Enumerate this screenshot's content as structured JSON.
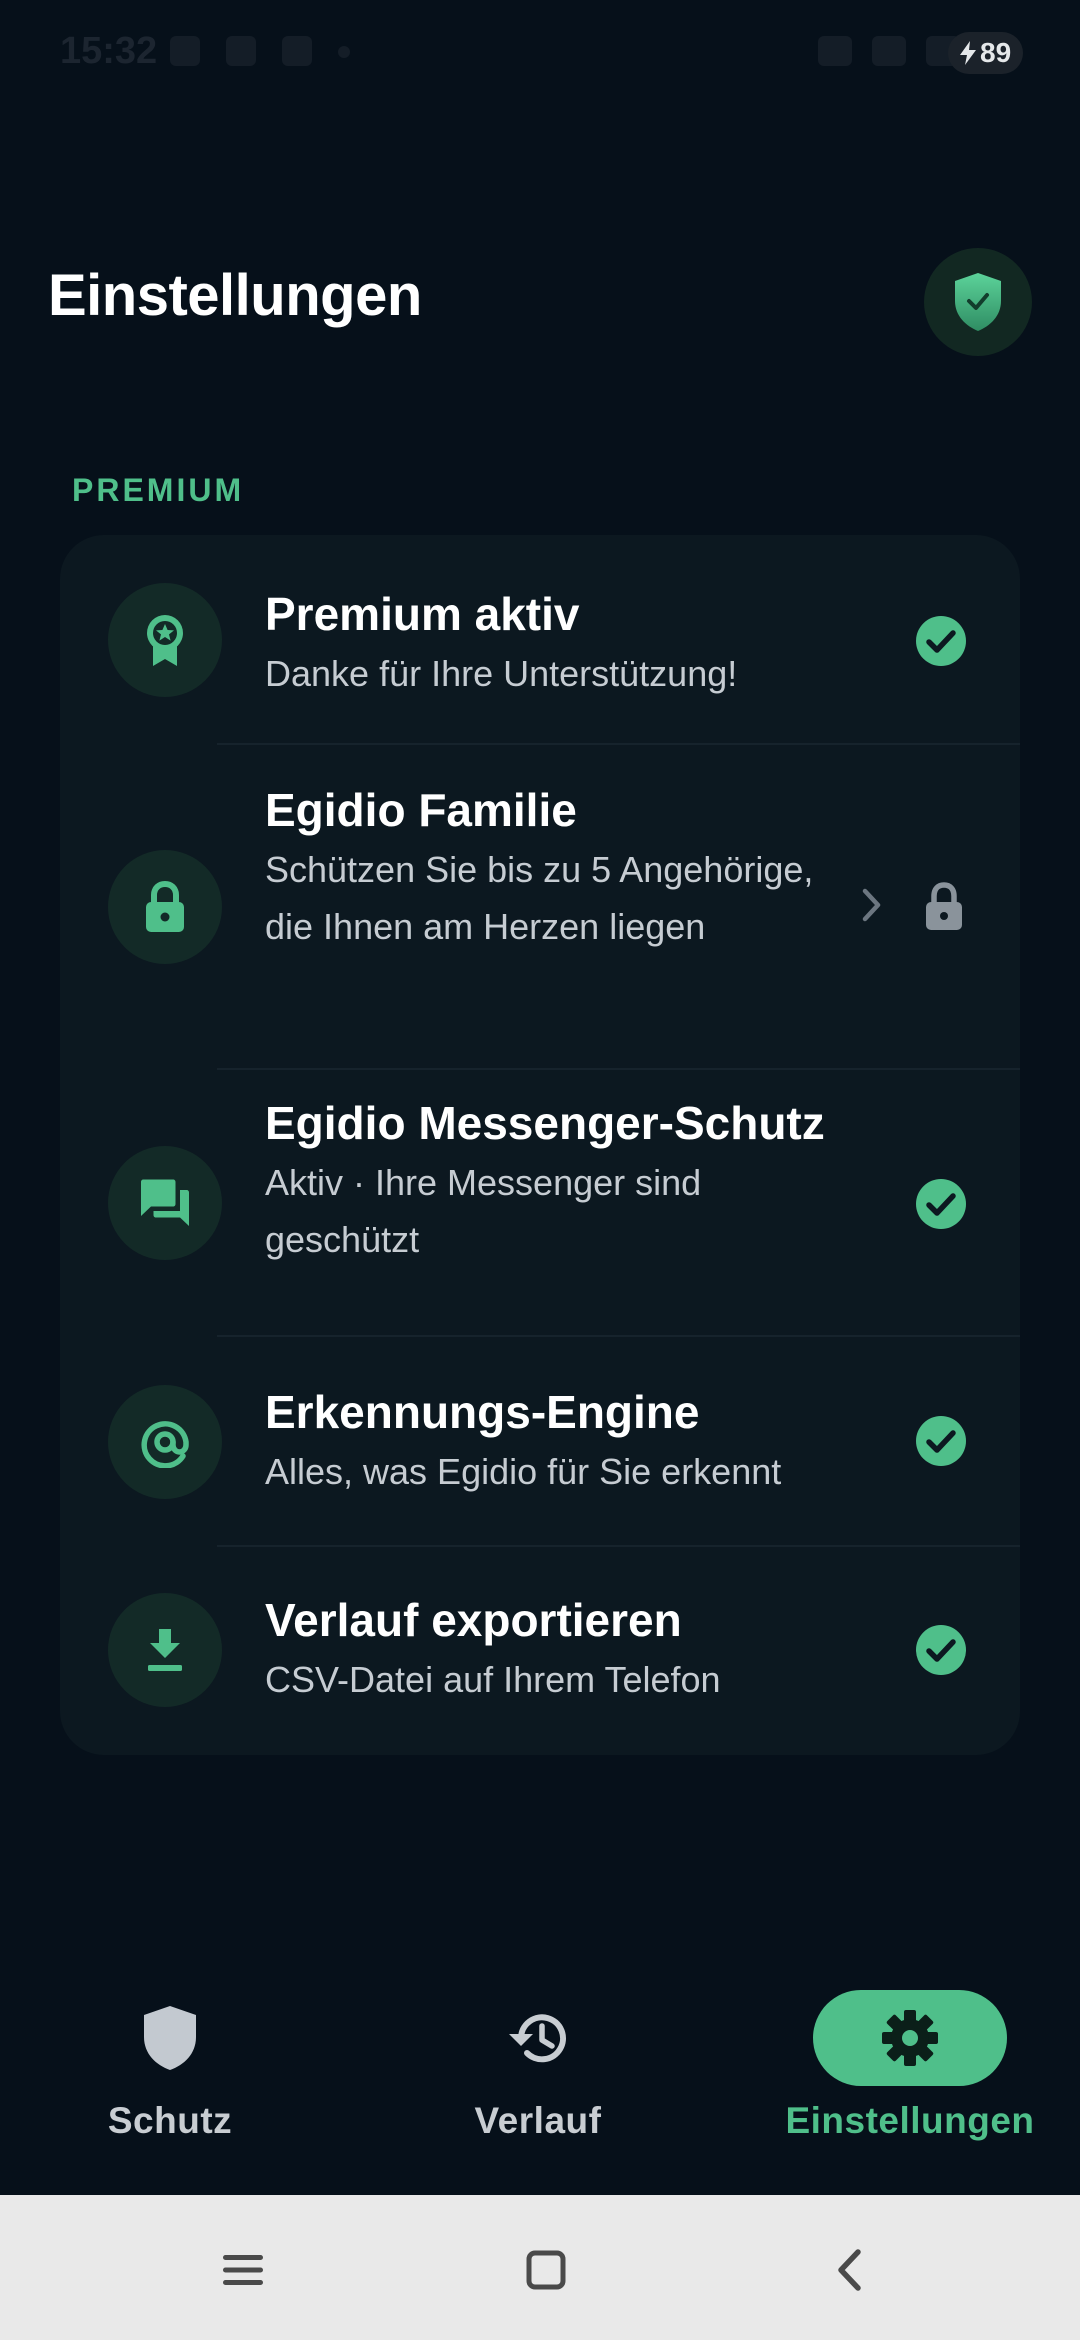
{
  "status_bar": {
    "time": "15:32",
    "battery_level": "89"
  },
  "header": {
    "title": "Einstellungen",
    "shield_button_icon": "shield-check-icon"
  },
  "section": {
    "label": "PREMIUM"
  },
  "items": [
    {
      "icon": "award-star-icon",
      "title": "Premium aktiv",
      "subtitle": "Danke für Ihre Unterstützung!",
      "status": "check"
    },
    {
      "icon": "lock-icon",
      "title": "Egidio Familie",
      "subtitle": "Schützen Sie bis zu 5 Angehörige, die Ihnen am Herzen liegen",
      "status": "locked"
    },
    {
      "icon": "chat-icon",
      "title": "Egidio Messenger-Schutz",
      "subtitle": "Aktiv · Ihre Messenger sind geschützt",
      "status": "check"
    },
    {
      "icon": "at-target-icon",
      "title": "Erkennungs-Engine",
      "subtitle": "Alles, was Egidio für Sie erkennt",
      "status": "check"
    },
    {
      "icon": "download-icon",
      "title": "Verlauf exportieren",
      "subtitle": "CSV-Datei auf Ihrem Telefon",
      "status": "check"
    }
  ],
  "bottom_nav": {
    "tabs": [
      {
        "label": "Schutz",
        "icon": "shield-icon",
        "active": false
      },
      {
        "label": "Verlauf",
        "icon": "history-icon",
        "active": false
      },
      {
        "label": "Einstellungen",
        "icon": "gear-icon",
        "active": true
      }
    ]
  },
  "colors": {
    "background": "#06101a",
    "card": "#0c1820",
    "accent": "#4fbf8a",
    "icon_circle": "#132a27",
    "system_nav": "#e9e9e9"
  }
}
